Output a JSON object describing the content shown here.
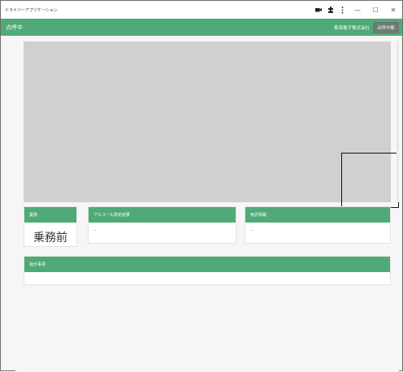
{
  "window": {
    "title": "ドライバーアプリケーション"
  },
  "titlebar": {
    "icons": [
      "camera-icon",
      "puzzle-icon",
      "more-icon"
    ],
    "controls": {
      "minimize": "—",
      "maximize": "☐",
      "close": "✕"
    }
  },
  "appbar": {
    "title": "点呼中",
    "company": "東海電子株式会社",
    "logout_label": "点呼中断"
  },
  "cards": {
    "status": {
      "header": "業務",
      "value": "乗務前"
    },
    "alcohol": {
      "header": "アルコール測定結果",
      "value": "-"
    },
    "license": {
      "header": "免許情報",
      "value": "-"
    },
    "instructions": {
      "header": "指示事項",
      "value": ""
    }
  },
  "colors": {
    "accent": "#4faa78",
    "camera_bg": "#d1cfcf",
    "logout_bg": "#6c7a72"
  }
}
